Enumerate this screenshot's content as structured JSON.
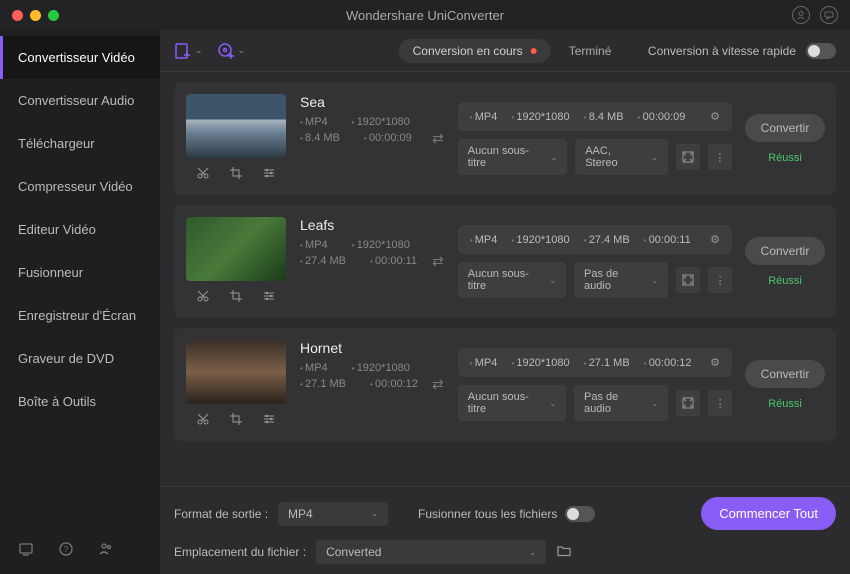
{
  "app_title": "Wondershare UniConverter",
  "sidebar": {
    "items": [
      {
        "label": "Convertisseur Vidéo",
        "active": true
      },
      {
        "label": "Convertisseur Audio"
      },
      {
        "label": "Téléchargeur"
      },
      {
        "label": "Compresseur Vidéo"
      },
      {
        "label": "Editeur Vidéo"
      },
      {
        "label": "Fusionneur"
      },
      {
        "label": "Enregistreur d'Écran"
      },
      {
        "label": "Graveur de DVD"
      },
      {
        "label": "Boîte à Outils"
      }
    ]
  },
  "toolbar": {
    "tab_active": "Conversion en cours",
    "tab_done": "Terminé",
    "speed_label": "Conversion à vitesse rapide"
  },
  "videos": [
    {
      "name": "Sea",
      "thumb": "sea",
      "in": {
        "fmt": "MP4",
        "res": "1920*1080",
        "size": "8.4 MB",
        "dur": "00:00:09"
      },
      "out": {
        "fmt": "MP4",
        "res": "1920*1080",
        "size": "8.4 MB",
        "dur": "00:00:09"
      },
      "subtitle": "Aucun sous-titre",
      "audio": "AAC, Stereo",
      "status": "Réussi"
    },
    {
      "name": "Leafs",
      "thumb": "leafs",
      "in": {
        "fmt": "MP4",
        "res": "1920*1080",
        "size": "27.4 MB",
        "dur": "00:00:11"
      },
      "out": {
        "fmt": "MP4",
        "res": "1920*1080",
        "size": "27.4 MB",
        "dur": "00:00:11"
      },
      "subtitle": "Aucun sous-titre",
      "audio": "Pas de audio",
      "status": "Réussi"
    },
    {
      "name": "Hornet",
      "thumb": "hornet",
      "in": {
        "fmt": "MP4",
        "res": "1920*1080",
        "size": "27.1 MB",
        "dur": "00:00:12"
      },
      "out": {
        "fmt": "MP4",
        "res": "1920*1080",
        "size": "27.1 MB",
        "dur": "00:00:12"
      },
      "subtitle": "Aucun sous-titre",
      "audio": "Pas de audio",
      "status": "Réussi"
    }
  ],
  "footer": {
    "output_label": "Format de sortie :",
    "output_value": "MP4",
    "merge_label": "Fusionner tous les fichiers",
    "location_label": "Emplacement du fichier :",
    "location_value": "Converted",
    "start_label": "Commencer Tout"
  },
  "labels": {
    "convert": "Convertir"
  }
}
